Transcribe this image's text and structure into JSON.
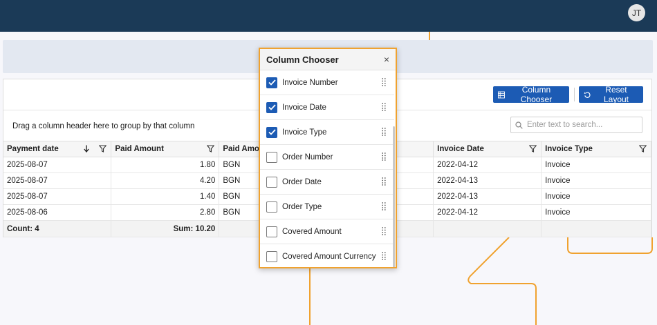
{
  "header": {
    "avatar_initials": "JT"
  },
  "toolbar": {
    "column_chooser_label": "Column Chooser",
    "reset_layout_label": "Reset Layout"
  },
  "group_panel": {
    "text": "Drag a column header here to group by that column"
  },
  "search": {
    "placeholder": "Enter text to search..."
  },
  "grid": {
    "columns": [
      "Payment date",
      "Paid Amount",
      "Paid Amo",
      "Invoice Date",
      "Invoice Type"
    ],
    "rows": [
      {
        "payment_date": "2025-08-07",
        "paid_amount": "1.80",
        "currency": "BGN",
        "invoice_date": "2022-04-12",
        "invoice_type": "Invoice"
      },
      {
        "payment_date": "2025-08-07",
        "paid_amount": "4.20",
        "currency": "BGN",
        "invoice_date": "2022-04-13",
        "invoice_type": "Invoice"
      },
      {
        "payment_date": "2025-08-07",
        "paid_amount": "1.40",
        "currency": "BGN",
        "invoice_date": "2022-04-13",
        "invoice_type": "Invoice"
      },
      {
        "payment_date": "2025-08-06",
        "paid_amount": "2.80",
        "currency": "BGN",
        "invoice_date": "2022-04-12",
        "invoice_type": "Invoice"
      }
    ],
    "footer": {
      "count": "Count: 4",
      "sum": "Sum: 10.20"
    }
  },
  "column_chooser": {
    "title": "Column Chooser",
    "close_glyph": "×",
    "items": [
      {
        "label": "Invoice Number",
        "checked": true
      },
      {
        "label": "Invoice Date",
        "checked": true
      },
      {
        "label": "Invoice Type",
        "checked": true
      },
      {
        "label": "Order Number",
        "checked": false
      },
      {
        "label": "Order Date",
        "checked": false
      },
      {
        "label": "Order Type",
        "checked": false
      },
      {
        "label": "Covered Amount",
        "checked": false
      },
      {
        "label": "Covered Amount Currency",
        "checked": false
      }
    ]
  },
  "colors": {
    "topbar": "#1b3a57",
    "accent": "#1c5bb4",
    "highlight": "#f0a22f"
  }
}
